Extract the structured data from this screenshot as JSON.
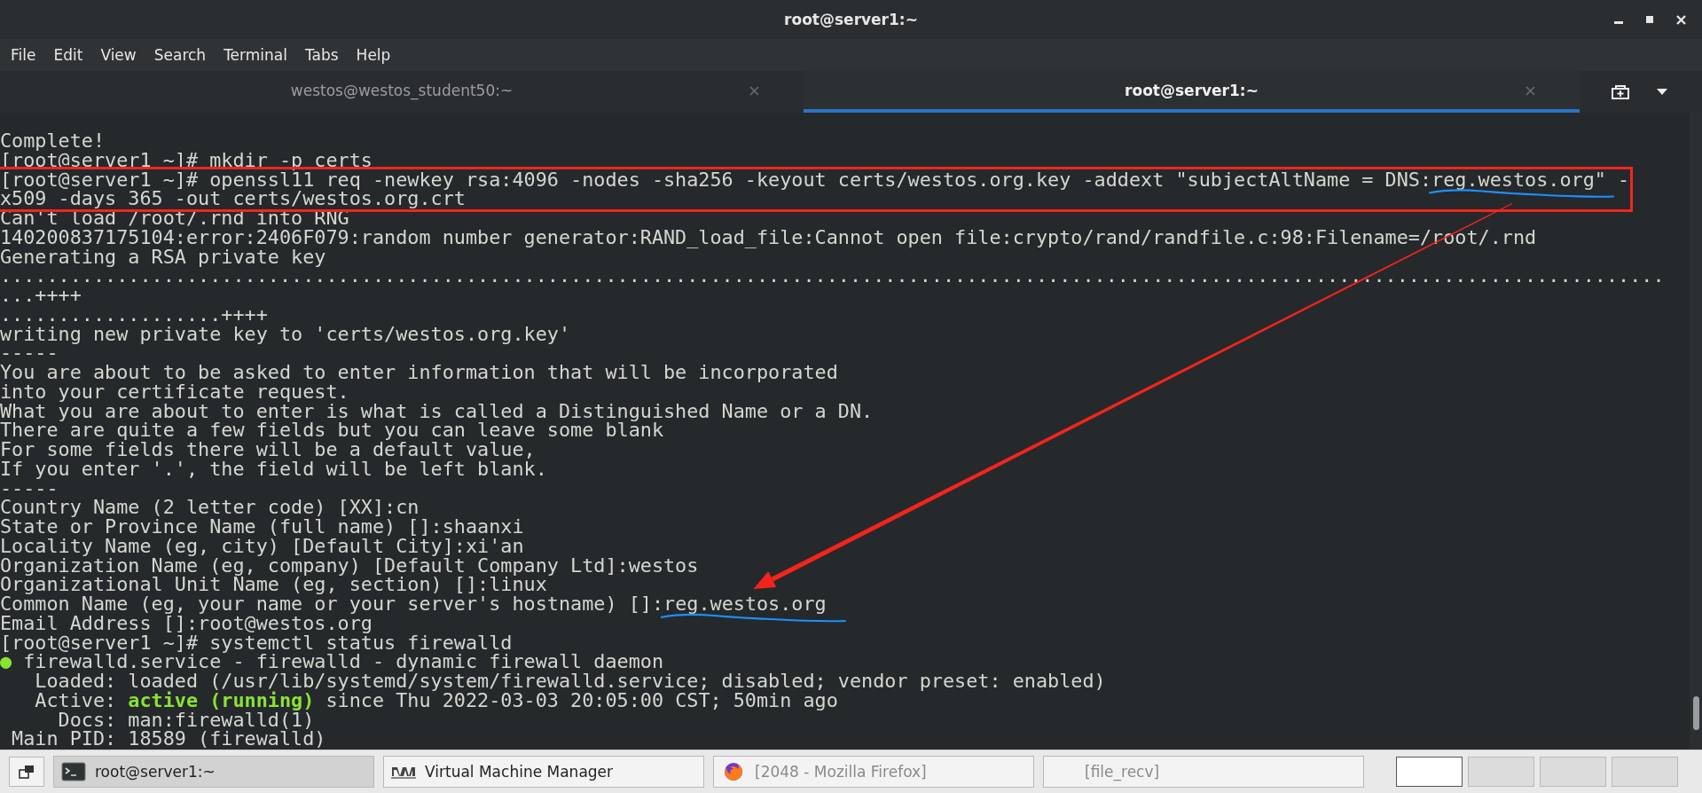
{
  "window": {
    "title": "root@server1:~"
  },
  "menu": [
    "File",
    "Edit",
    "View",
    "Search",
    "Terminal",
    "Tabs",
    "Help"
  ],
  "tabs": [
    {
      "label": "westos@westos_student50:~",
      "selected": false
    },
    {
      "label": "root@server1:~",
      "selected": true
    }
  ],
  "terminal": {
    "annotation_arrow": true,
    "lines": [
      {
        "text": "Complete!"
      },
      {
        "text": "[root@server1 ~]# mkdir -p certs"
      },
      {
        "boxed": true,
        "parts": [
          {
            "text": "[root@server1 ~]# openssl11 req -newkey rsa:4096 -nodes -sha256 -keyout certs/westos.org.key -addext \"subjectAltName = DNS:"
          },
          {
            "text": "reg.westos.org",
            "underlined": true
          },
          {
            "text": "\" -"
          }
        ]
      },
      {
        "boxed": true,
        "text": "x509 -days 365 -out certs/westos.org.crt"
      },
      {
        "text": "Can't load /root/.rnd into RNG"
      },
      {
        "text": "140200837175104:error:2406F079:random number generator:RAND_load_file:Cannot open file:crypto/rand/randfile.c:98:Filename=/root/.rnd"
      },
      {
        "text": "Generating a RSA private key"
      },
      {
        "text": "..............................................................................................................................................."
      },
      {
        "text": "...++++"
      },
      {
        "text": "...................++++"
      },
      {
        "text": "writing new private key to 'certs/westos.org.key'"
      },
      {
        "text": "-----"
      },
      {
        "text": "You are about to be asked to enter information that will be incorporated"
      },
      {
        "text": "into your certificate request."
      },
      {
        "text": "What you are about to enter is what is called a Distinguished Name or a DN."
      },
      {
        "text": "There are quite a few fields but you can leave some blank"
      },
      {
        "text": "For some fields there will be a default value,"
      },
      {
        "text": "If you enter '.', the field will be left blank."
      },
      {
        "text": "-----"
      },
      {
        "text": "Country Name (2 letter code) [XX]:cn"
      },
      {
        "text": "State or Province Name (full name) []:shaanxi"
      },
      {
        "text": "Locality Name (eg, city) [Default City]:xi'an"
      },
      {
        "text": "Organization Name (eg, company) [Default Company Ltd]:westos"
      },
      {
        "text": "Organizational Unit Name (eg, section) []:linux"
      },
      {
        "parts": [
          {
            "text": "Common Name (eg, your name or your server's hostname) []:"
          },
          {
            "text": "reg.westos.org",
            "underlined": true
          }
        ]
      },
      {
        "text": "Email Address []:root@westos.org"
      },
      {
        "text": "[root@server1 ~]# systemctl status firewalld"
      },
      {
        "bullet": "●",
        "text": " firewalld.service - firewalld - dynamic firewall daemon"
      },
      {
        "text": "   Loaded: loaded (/usr/lib/systemd/system/firewalld.service; disabled; vendor preset: enabled)"
      },
      {
        "text": "   Active: **active (running)** since Thu 2022-03-03 20:05:00 CST; 50min ago"
      },
      {
        "text": "     Docs: man:firewalld(1)"
      },
      {
        "text": " Main PID: 18589 (firewalld)"
      }
    ]
  },
  "taskbar": {
    "items": [
      {
        "label": "root@server1:~",
        "kind": "terminal",
        "selected": true,
        "minimized": false
      },
      {
        "label": "Virtual Machine Manager",
        "kind": "manager",
        "selected": false,
        "minimized": false
      },
      {
        "label": "[2048 - Mozilla Firefox]",
        "kind": "browser",
        "selected": false,
        "minimized": true
      },
      {
        "label": "[file_recv]",
        "kind": "plain",
        "selected": false,
        "minimized": true
      }
    ],
    "workspaces": [
      {
        "selected": true
      },
      {
        "selected": false
      },
      {
        "selected": false
      },
      {
        "selected": false
      }
    ]
  }
}
